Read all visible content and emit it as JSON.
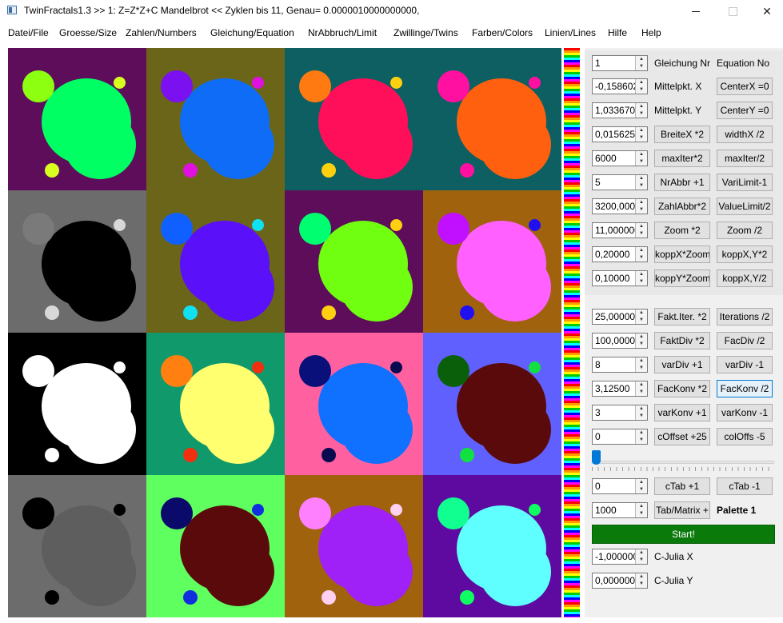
{
  "window": {
    "title": "TwinFractals1.3 >> 1: Z=Z*Z+C Mandelbrot << Zyklen bis 11, Genau= 0.0000010000000000,",
    "minimize_symbol": "—",
    "maximize_symbol": "☐",
    "close_symbol": "✕"
  },
  "menu": [
    "Datei/File",
    "Groesse/Size",
    "Zahlen/Numbers",
    "Gleichung/Equation",
    "NrAbbruch/Limit",
    "Zwillinge/Twins",
    "Farben/Colors",
    "Linien/Lines",
    "Hilfe",
    "Help"
  ],
  "fractal_grid": {
    "rows": 4,
    "cols": 4,
    "cells": [
      {
        "bg": "#5e0d5a",
        "fg": "#00ff62",
        "big_dot": "#8dff10",
        "small_dot": "#d8ff20"
      },
      {
        "bg": "#6b6519",
        "fg": "#0f6cf7",
        "big_dot": "#7b10f0",
        "small_dot": "#e010e0"
      },
      {
        "bg": "#0d5f62",
        "fg": "#ff0f5a",
        "big_dot": "#ff7a10",
        "small_dot": "#ffd010"
      },
      {
        "bg": "#0d5f62",
        "fg": "#ff6010",
        "big_dot": "#ff10a0",
        "small_dot": "#ff10a0"
      },
      {
        "bg": "#6c6c6c",
        "fg": "#000000",
        "big_dot": "#7a7a7a",
        "small_dot": "#d8d8d8"
      },
      {
        "bg": "#6b6519",
        "fg": "#5a10f8",
        "big_dot": "#1060ff",
        "small_dot": "#10e0f0"
      },
      {
        "bg": "#5e0d5a",
        "fg": "#70ff10",
        "big_dot": "#00ff70",
        "small_dot": "#ffd010"
      },
      {
        "bg": "#a0620d",
        "fg": "#ff60ff",
        "big_dot": "#c010ff",
        "small_dot": "#2010f0"
      },
      {
        "bg": "#000000",
        "fg": "#ffffff",
        "big_dot": "#ffffff",
        "small_dot": "#ffffff"
      },
      {
        "bg": "#10996a",
        "fg": "#ffff70",
        "big_dot": "#ff8010",
        "small_dot": "#f03010"
      },
      {
        "bg": "#ff60a0",
        "fg": "#1070ff",
        "big_dot": "#0a107a",
        "small_dot": "#0a0a50"
      },
      {
        "bg": "#6060ff",
        "fg": "#5a0a0a",
        "big_dot": "#0a600a",
        "small_dot": "#10e040"
      },
      {
        "bg": "#6c6c6c",
        "fg": "#5e5e5e",
        "big_dot": "#000000",
        "small_dot": "#000000"
      },
      {
        "bg": "#60ff60",
        "fg": "#5a0a0a",
        "big_dot": "#0a0a6a",
        "small_dot": "#1030e0"
      },
      {
        "bg": "#a0620d",
        "fg": "#a020f8",
        "big_dot": "#ff80ff",
        "small_dot": "#ffd0f0"
      },
      {
        "bg": "#5e0aa0",
        "fg": "#60ffff",
        "big_dot": "#10ff90",
        "small_dot": "#10ff60"
      }
    ]
  },
  "color_strip": [
    "#ff0000",
    "#ff9900",
    "#ffff00",
    "#00cc00",
    "#00ffff",
    "#0000ff",
    "#ff00ff"
  ],
  "panel": {
    "header": {
      "col1": "Gleichung Nr",
      "col2": "Equation No"
    },
    "rows_top": [
      {
        "value": "1",
        "label": "Gleichung Nr",
        "btn2": "Equation No"
      },
      {
        "value": "-0,1586020",
        "label": "Mittelpkt. X",
        "btn2": "CenterX =0"
      },
      {
        "value": "1,0336700",
        "label": "Mittelpkt. Y",
        "btn2": "CenterY =0"
      },
      {
        "value": "0,0156250",
        "btn1": "BreiteX *2",
        "btn2": "widthX /2"
      },
      {
        "value": "6000",
        "btn1": "maxIter*2",
        "btn2": "maxIter/2"
      },
      {
        "value": "5",
        "btn1": "NrAbbr +1",
        "btn2": "VariLimit-1"
      },
      {
        "value": "3200,00000",
        "btn1": "ZahlAbbr*2",
        "btn2": "ValueLimit/2"
      },
      {
        "value": "11,0000000",
        "btn1": "Zoom *2",
        "btn2": "Zoom /2"
      },
      {
        "value": "0,20000",
        "btn1": "koppX*Zoom",
        "btn2": "koppX,Y*2"
      },
      {
        "value": "0,10000",
        "btn1": "koppY*Zoom",
        "btn2": "koppX,Y/2"
      }
    ],
    "rows_bottom": [
      {
        "value": "25,00000",
        "btn1": "Fakt.Iter. *2",
        "btn2": "Iterations /2"
      },
      {
        "value": "100,00000",
        "btn1": "FaktDiv *2",
        "btn2": "FacDiv /2"
      },
      {
        "value": "8",
        "btn1": "varDiv +1",
        "btn2": "varDiv -1"
      },
      {
        "value": "3,12500",
        "btn1": "FacKonv *2",
        "btn2": "FacKonv /2"
      },
      {
        "value": "3",
        "btn1": "varKonv +1",
        "btn2": "varKonv -1"
      },
      {
        "value": "0",
        "btn1": "cOffset +25",
        "btn2": "colOffs -5"
      }
    ],
    "slider_value": 0,
    "ctab": {
      "value": "0",
      "btn1": "cTab +1",
      "btn2": "cTab -1"
    },
    "tab_matrix": {
      "value": "1000",
      "btn1": "Tab/Matrix +",
      "label": "Palette 1"
    },
    "start_label": "Start!",
    "julia_x": {
      "value": "-1,0000000",
      "label": "C-Julia X"
    },
    "julia_y": {
      "value": "0,0000000",
      "label": "C-Julia Y"
    }
  }
}
